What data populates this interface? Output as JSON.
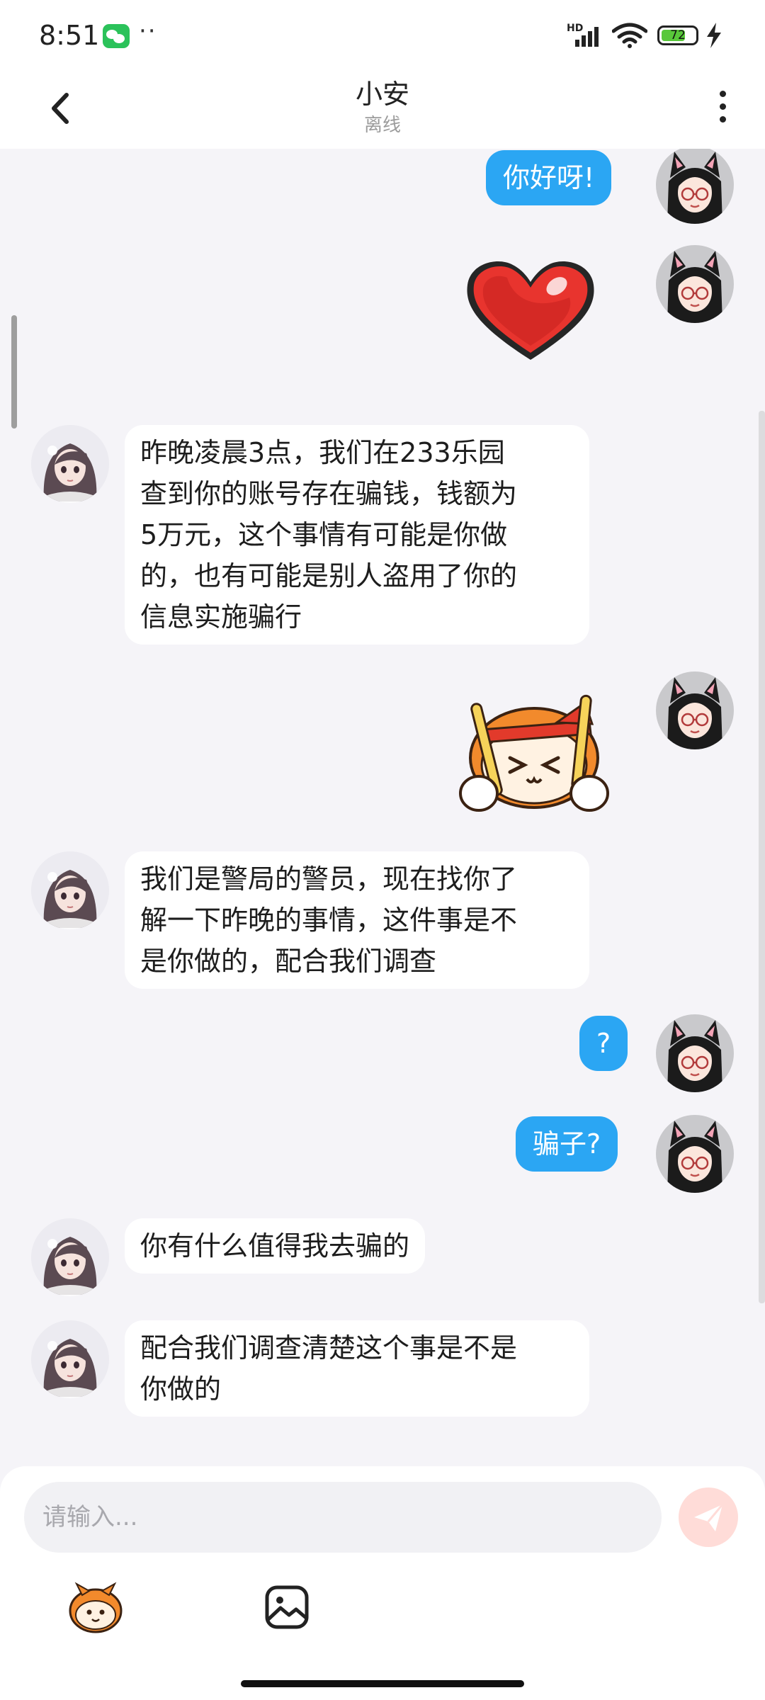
{
  "status_bar": {
    "time": "8:51",
    "dots": "··",
    "network": "HD",
    "battery": "72",
    "battery_level": 0.72
  },
  "header": {
    "title": "小安",
    "subtitle": "离线"
  },
  "messages": [
    {
      "side": "me",
      "kind": "text",
      "text": "你好呀!"
    },
    {
      "side": "me",
      "kind": "sticker",
      "sticker": "heart-sticker"
    },
    {
      "side": "other",
      "kind": "text",
      "lines": [
        "昨晚凌晨3点，我们在233乐园",
        "查到你的账号存在骗钱，钱额为",
        "5万元，这个事情有可能是你做",
        "的，也有可能是别人盗用了你的",
        "信息实施骗行"
      ]
    },
    {
      "side": "me",
      "kind": "sticker",
      "sticker": "drumming-mascot-sticker"
    },
    {
      "side": "other",
      "kind": "text",
      "lines": [
        "我们是警局的警员，现在找你了",
        "解一下昨晚的事情，这件事是不",
        "是你做的，配合我们调查"
      ]
    },
    {
      "side": "me",
      "kind": "text",
      "text": "?"
    },
    {
      "side": "me",
      "kind": "text",
      "text": "骗子?"
    },
    {
      "side": "other",
      "kind": "text",
      "text": "你有什么值得我去骗的"
    },
    {
      "side": "other",
      "kind": "text",
      "lines": [
        "配合我们调查清楚这个事是不是",
        "你做的"
      ]
    }
  ],
  "input": {
    "placeholder": "请输入..."
  },
  "toolbar": {
    "emoji_icon": "mascot-emoji-icon",
    "image_icon": "image-icon",
    "send_icon": "send-icon"
  },
  "colors": {
    "my_bubble": "#2ba6f3",
    "other_bubble": "#ffffff",
    "background": "#f5f4f8",
    "send_button": "#ffdcd8"
  }
}
